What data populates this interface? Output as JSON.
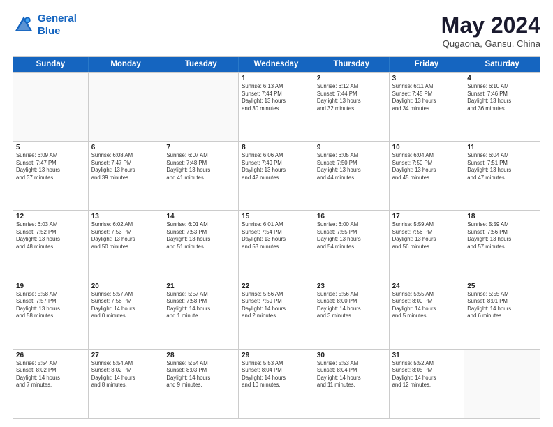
{
  "logo": {
    "line1": "General",
    "line2": "Blue"
  },
  "title": "May 2024",
  "subtitle": "Qugaona, Gansu, China",
  "header_days": [
    "Sunday",
    "Monday",
    "Tuesday",
    "Wednesday",
    "Thursday",
    "Friday",
    "Saturday"
  ],
  "weeks": [
    [
      {
        "date": "",
        "info": ""
      },
      {
        "date": "",
        "info": ""
      },
      {
        "date": "",
        "info": ""
      },
      {
        "date": "1",
        "info": "Sunrise: 6:13 AM\nSunset: 7:44 PM\nDaylight: 13 hours\nand 30 minutes."
      },
      {
        "date": "2",
        "info": "Sunrise: 6:12 AM\nSunset: 7:44 PM\nDaylight: 13 hours\nand 32 minutes."
      },
      {
        "date": "3",
        "info": "Sunrise: 6:11 AM\nSunset: 7:45 PM\nDaylight: 13 hours\nand 34 minutes."
      },
      {
        "date": "4",
        "info": "Sunrise: 6:10 AM\nSunset: 7:46 PM\nDaylight: 13 hours\nand 36 minutes."
      }
    ],
    [
      {
        "date": "5",
        "info": "Sunrise: 6:09 AM\nSunset: 7:47 PM\nDaylight: 13 hours\nand 37 minutes."
      },
      {
        "date": "6",
        "info": "Sunrise: 6:08 AM\nSunset: 7:47 PM\nDaylight: 13 hours\nand 39 minutes."
      },
      {
        "date": "7",
        "info": "Sunrise: 6:07 AM\nSunset: 7:48 PM\nDaylight: 13 hours\nand 41 minutes."
      },
      {
        "date": "8",
        "info": "Sunrise: 6:06 AM\nSunset: 7:49 PM\nDaylight: 13 hours\nand 42 minutes."
      },
      {
        "date": "9",
        "info": "Sunrise: 6:05 AM\nSunset: 7:50 PM\nDaylight: 13 hours\nand 44 minutes."
      },
      {
        "date": "10",
        "info": "Sunrise: 6:04 AM\nSunset: 7:50 PM\nDaylight: 13 hours\nand 45 minutes."
      },
      {
        "date": "11",
        "info": "Sunrise: 6:04 AM\nSunset: 7:51 PM\nDaylight: 13 hours\nand 47 minutes."
      }
    ],
    [
      {
        "date": "12",
        "info": "Sunrise: 6:03 AM\nSunset: 7:52 PM\nDaylight: 13 hours\nand 48 minutes."
      },
      {
        "date": "13",
        "info": "Sunrise: 6:02 AM\nSunset: 7:53 PM\nDaylight: 13 hours\nand 50 minutes."
      },
      {
        "date": "14",
        "info": "Sunrise: 6:01 AM\nSunset: 7:53 PM\nDaylight: 13 hours\nand 51 minutes."
      },
      {
        "date": "15",
        "info": "Sunrise: 6:01 AM\nSunset: 7:54 PM\nDaylight: 13 hours\nand 53 minutes."
      },
      {
        "date": "16",
        "info": "Sunrise: 6:00 AM\nSunset: 7:55 PM\nDaylight: 13 hours\nand 54 minutes."
      },
      {
        "date": "17",
        "info": "Sunrise: 5:59 AM\nSunset: 7:56 PM\nDaylight: 13 hours\nand 56 minutes."
      },
      {
        "date": "18",
        "info": "Sunrise: 5:59 AM\nSunset: 7:56 PM\nDaylight: 13 hours\nand 57 minutes."
      }
    ],
    [
      {
        "date": "19",
        "info": "Sunrise: 5:58 AM\nSunset: 7:57 PM\nDaylight: 13 hours\nand 58 minutes."
      },
      {
        "date": "20",
        "info": "Sunrise: 5:57 AM\nSunset: 7:58 PM\nDaylight: 14 hours\nand 0 minutes."
      },
      {
        "date": "21",
        "info": "Sunrise: 5:57 AM\nSunset: 7:58 PM\nDaylight: 14 hours\nand 1 minute."
      },
      {
        "date": "22",
        "info": "Sunrise: 5:56 AM\nSunset: 7:59 PM\nDaylight: 14 hours\nand 2 minutes."
      },
      {
        "date": "23",
        "info": "Sunrise: 5:56 AM\nSunset: 8:00 PM\nDaylight: 14 hours\nand 3 minutes."
      },
      {
        "date": "24",
        "info": "Sunrise: 5:55 AM\nSunset: 8:00 PM\nDaylight: 14 hours\nand 5 minutes."
      },
      {
        "date": "25",
        "info": "Sunrise: 5:55 AM\nSunset: 8:01 PM\nDaylight: 14 hours\nand 6 minutes."
      }
    ],
    [
      {
        "date": "26",
        "info": "Sunrise: 5:54 AM\nSunset: 8:02 PM\nDaylight: 14 hours\nand 7 minutes."
      },
      {
        "date": "27",
        "info": "Sunrise: 5:54 AM\nSunset: 8:02 PM\nDaylight: 14 hours\nand 8 minutes."
      },
      {
        "date": "28",
        "info": "Sunrise: 5:54 AM\nSunset: 8:03 PM\nDaylight: 14 hours\nand 9 minutes."
      },
      {
        "date": "29",
        "info": "Sunrise: 5:53 AM\nSunset: 8:04 PM\nDaylight: 14 hours\nand 10 minutes."
      },
      {
        "date": "30",
        "info": "Sunrise: 5:53 AM\nSunset: 8:04 PM\nDaylight: 14 hours\nand 11 minutes."
      },
      {
        "date": "31",
        "info": "Sunrise: 5:52 AM\nSunset: 8:05 PM\nDaylight: 14 hours\nand 12 minutes."
      },
      {
        "date": "",
        "info": ""
      }
    ]
  ]
}
